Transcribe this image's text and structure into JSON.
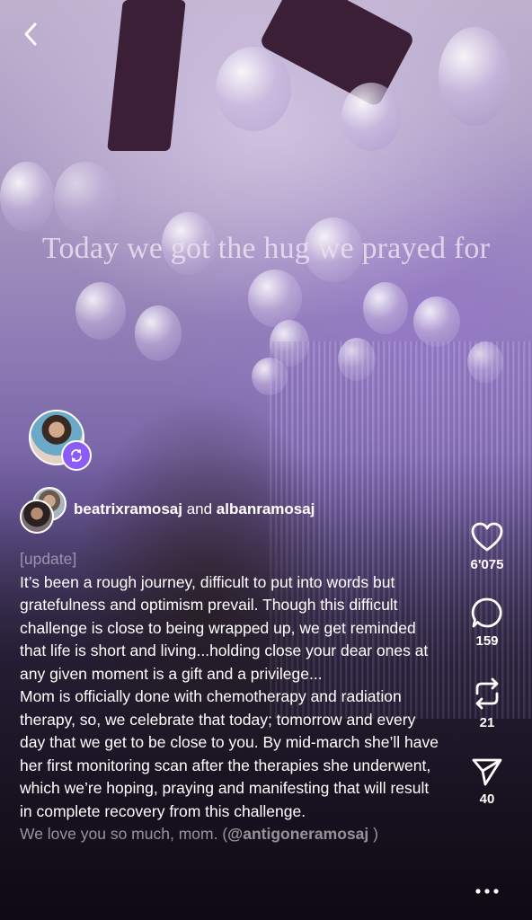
{
  "video": {
    "overlay_text": "Today we got the hug we prayed for"
  },
  "post": {
    "author1": "beatrixramosaj",
    "connector": "and",
    "author2": "albanramosaj",
    "description_update": "[update]",
    "description_p1": "It’s been a rough journey, difficult to put into words but gratefulness and optimism prevail. Though this difficult challenge is close to being wrapped up, we get reminded that life is short and living...holding close your dear ones at any given moment is a gift and a privilege...",
    "description_p2": "Mom is officially done with chemotherapy and radiation therapy, so, we celebrate that today; tomorrow and every day that we get to be close to you. By mid-march she’ll have her first monitoring scan after the therapies she underwent, which we’re hoping, praying and manifesting that will result in complete recovery from this challenge.",
    "description_p3_start": "We love you so much, mom. (",
    "description_mention": "@antigoneramosaj",
    "description_p3_end": " )"
  },
  "actions": {
    "likes": "6'075",
    "comments": "159",
    "reposts": "21",
    "shares": "40"
  },
  "icons": {
    "back": "chevron-left-icon",
    "like": "heart-icon",
    "comment": "comment-bubble-icon",
    "repost": "repost-icon",
    "share": "send-icon",
    "more": "more-dots-icon",
    "repost_badge": "repost-badge-icon"
  },
  "colors": {
    "repost_badge": "#8b5cf6",
    "text": "#ffffff"
  }
}
